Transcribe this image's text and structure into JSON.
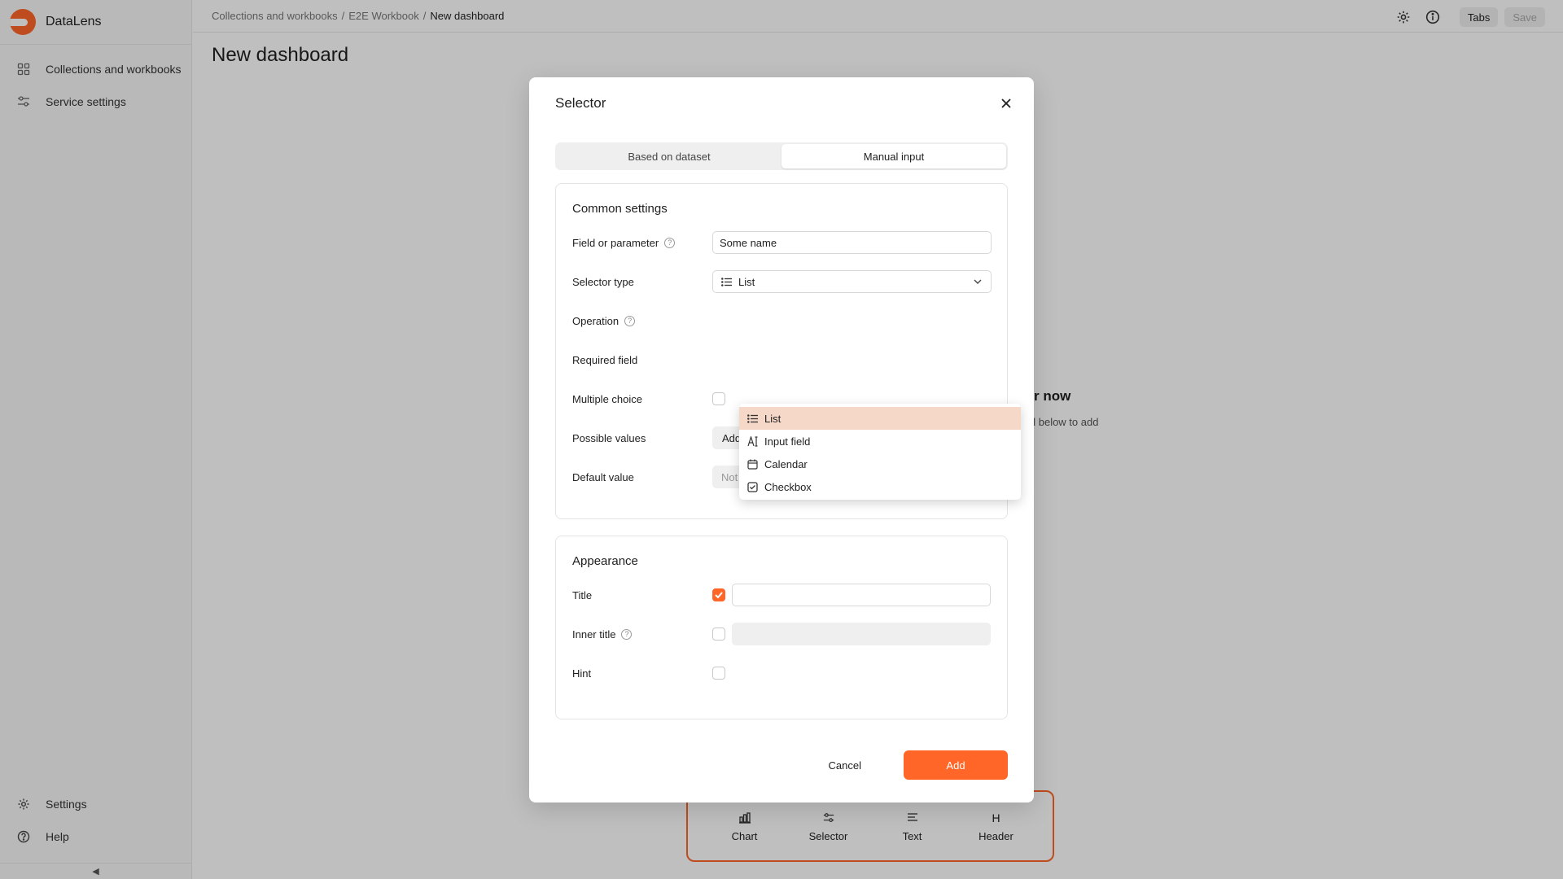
{
  "sidebar": {
    "brand": "DataLens",
    "items": [
      {
        "label": "Collections and workbooks",
        "icon": "grid-icon"
      },
      {
        "label": "Service settings",
        "icon": "sliders-icon"
      }
    ],
    "bottom_items": [
      {
        "label": "Settings",
        "icon": "gear-icon"
      },
      {
        "label": "Help",
        "icon": "help-icon"
      }
    ],
    "collapse_glyph": "◀"
  },
  "header": {
    "breadcrumbs": [
      "Collections and workbooks",
      "E2E Workbook",
      "New dashboard"
    ],
    "separator": "/",
    "tabs_label": "Tabs",
    "save_label": "Save"
  },
  "page": {
    "title": "New dashboard",
    "empty_title_fragment": "r now",
    "empty_sub_fragment": "el below to add"
  },
  "widgets": [
    {
      "label": "Chart",
      "icon": "chart-icon"
    },
    {
      "label": "Selector",
      "icon": "sliders-icon"
    },
    {
      "label": "Text",
      "icon": "text-icon"
    },
    {
      "label": "Header",
      "icon": "header-icon",
      "glyph": "H"
    }
  ],
  "modal": {
    "title": "Selector",
    "segments": [
      "Based on dataset",
      "Manual input"
    ],
    "active_segment": "Manual input",
    "common": {
      "title": "Common settings",
      "field_label": "Field or parameter",
      "field_value": "Some name",
      "type_label": "Selector type",
      "type_value": "List",
      "operation_label": "Operation",
      "required_label": "Required field",
      "multiple_label": "Multiple choice",
      "possible_label": "Possible values",
      "possible_add": "Add",
      "default_label": "Default value",
      "default_placeholder": "Not defined"
    },
    "dropdown_options": [
      {
        "label": "List",
        "icon": "list-icon",
        "selected": true
      },
      {
        "label": "Input field",
        "icon": "text-cursor-icon",
        "selected": false
      },
      {
        "label": "Calendar",
        "icon": "calendar-icon",
        "selected": false
      },
      {
        "label": "Checkbox",
        "icon": "checkbox-icon",
        "selected": false
      }
    ],
    "appearance": {
      "title": "Appearance",
      "title_label": "Title",
      "title_checked": true,
      "inner_title_label": "Inner title",
      "inner_title_checked": false,
      "hint_label": "Hint",
      "hint_checked": false
    },
    "cancel_label": "Cancel",
    "add_label": "Add"
  },
  "colors": {
    "accent": "#ff6628",
    "selected_option": "#f6d8c9"
  }
}
